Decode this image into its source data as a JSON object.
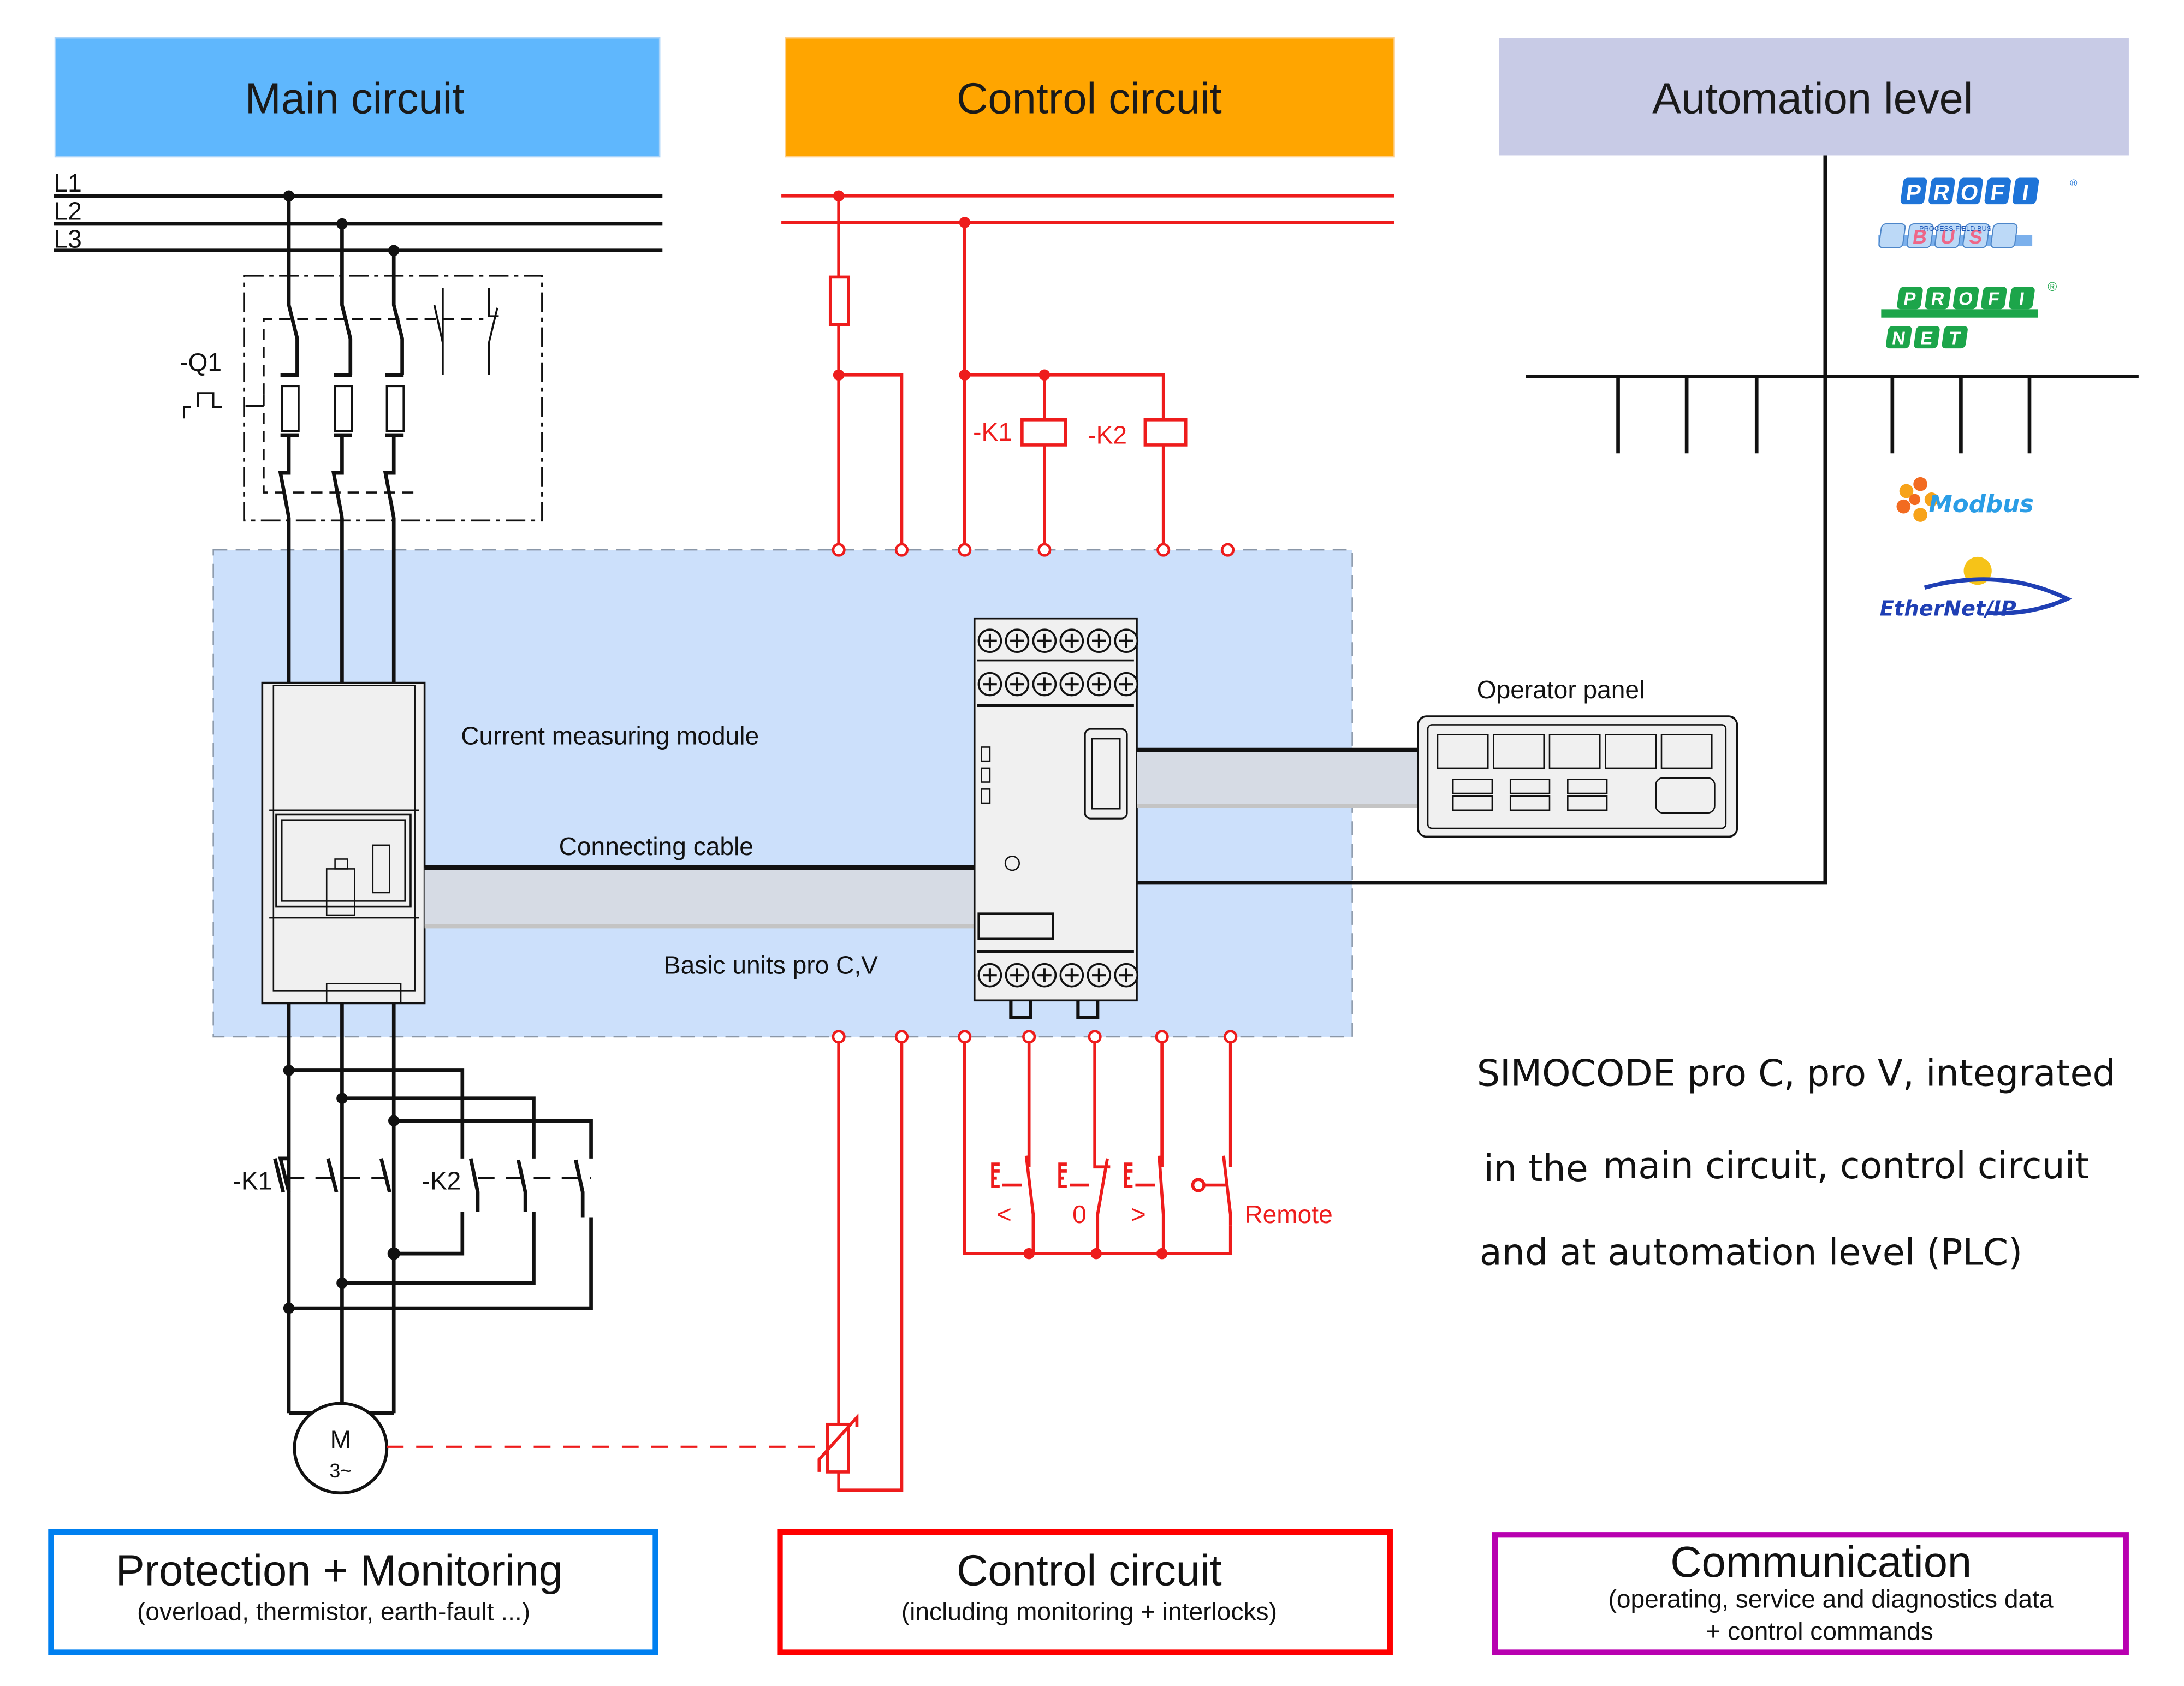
{
  "headers": {
    "main": "Main circuit",
    "control": "Control circuit",
    "automation": "Automation level"
  },
  "colors": {
    "main_header": "#5fb7fd",
    "control_header": "#ffa500",
    "automation_header": "#c8cbe6",
    "device_area": "#cce0fb",
    "control_wire": "#ee1c1c",
    "protection_border": "#0080f0",
    "control_border": "#ff0000",
    "communication_border": "#b800b0"
  },
  "main_circuit": {
    "phases": [
      "L1",
      "L2",
      "L3"
    ],
    "breaker_label": "-Q1",
    "contactor_k1": "-K1",
    "contactor_k2": "-K2",
    "motor_label": "M",
    "motor_sub": "3~"
  },
  "control_circuit": {
    "coil_k1": "-K1",
    "coil_k2": "-K2",
    "button_left": "<",
    "button_off": "0",
    "button_right": ">",
    "remote_label": "Remote"
  },
  "devices": {
    "current_module": "Current measuring module",
    "cable": "Connecting cable",
    "basic_unit": "Basic units pro C,V",
    "operator_panel": "Operator panel"
  },
  "protocols": [
    "PROFIBUS",
    "PROFINET",
    "Modbus",
    "EtherNet/IP"
  ],
  "protocol_text": {
    "profi": "PROFI",
    "bus": "BUS",
    "net": "NET",
    "process_field_bus": "PROCESS FIELD BUS",
    "modbus": "Modbus",
    "ethernet": "EtherNet/IP"
  },
  "description": {
    "line1": "SIMOCODE pro C, pro V, integrated",
    "line2a": "in the",
    "line2b": "main circuit, control circuit",
    "line3": "and at automation level (PLC)"
  },
  "bottom_boxes": {
    "protection": {
      "title": "Protection + Monitoring",
      "subtitle": "(overload, thermistor, earth-fault ...)"
    },
    "control": {
      "title": "Control circuit",
      "subtitle": "(including monitoring + interlocks)"
    },
    "communication": {
      "title": "Communication",
      "subtitle1": "(operating, service and diagnostics data",
      "subtitle2": "+ control commands"
    }
  }
}
